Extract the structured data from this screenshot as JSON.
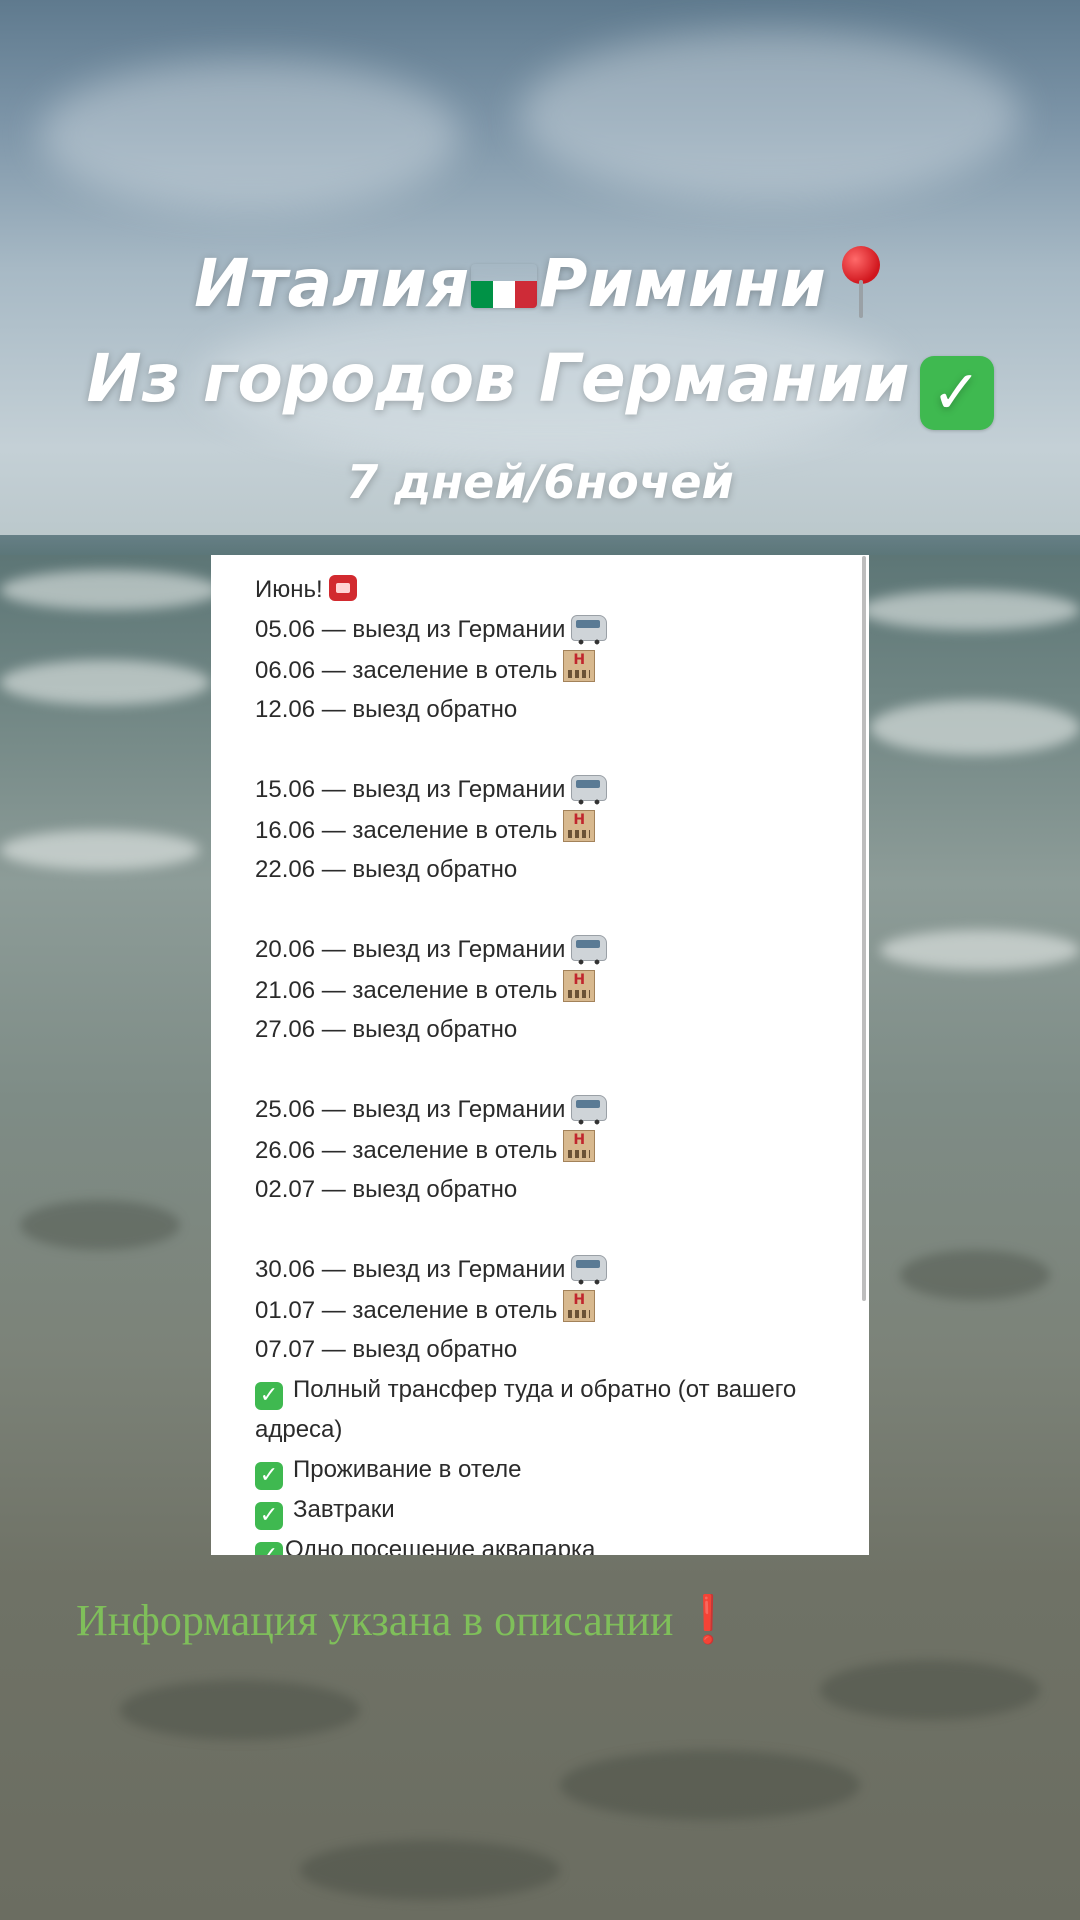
{
  "header": {
    "line1_a": "Италия",
    "line1_b": "Римини",
    "line2": "Из городов Германии",
    "duration": "7 дней/6ночей"
  },
  "icons": {
    "flag": "italy-flag-icon",
    "pin": "round-pushpin-icon",
    "check": "check-mark-button-icon",
    "phone": "telephone-icon",
    "bus": "minibus-icon",
    "hotel": "hotel-icon",
    "exclamation": "exclamation-mark-icon"
  },
  "colors": {
    "flag_green": "#009246",
    "flag_white": "#ffffff",
    "flag_red": "#ce2b37",
    "check_green": "#3fb950",
    "note_green": "#7fbf5a",
    "note_red": "#e0232b"
  },
  "schedule": {
    "heading": "Июнь!",
    "groups": [
      {
        "depart": "05.06 — выезд из Германии",
        "checkin": "06.06 — заселение в отель",
        "return": "12.06 — выезд обратно"
      },
      {
        "depart": "15.06 — выезд из Германии",
        "checkin": "16.06 — заселение в отель",
        "return": "22.06 — выезд обратно"
      },
      {
        "depart": "20.06 — выезд из Германии",
        "checkin": "21.06 — заселение в отель",
        "return": "27.06 — выезд обратно"
      },
      {
        "depart": "25.06 — выезд из Германии",
        "checkin": "26.06 — заселение в отель",
        "return": "02.07 — выезд обратно"
      },
      {
        "depart": "30.06 — выезд из Германии",
        "checkin": "01.07 — заселение в отель",
        "return": "07.07 — выезд обратно"
      }
    ],
    "includes": [
      "Полный трансфер туда и обратно (от вашего адреса)",
      "Проживание в отеле",
      "Завтраки",
      "Одно посещение аквапарка"
    ]
  },
  "footer": {
    "note": "Информация укзана в описании"
  }
}
